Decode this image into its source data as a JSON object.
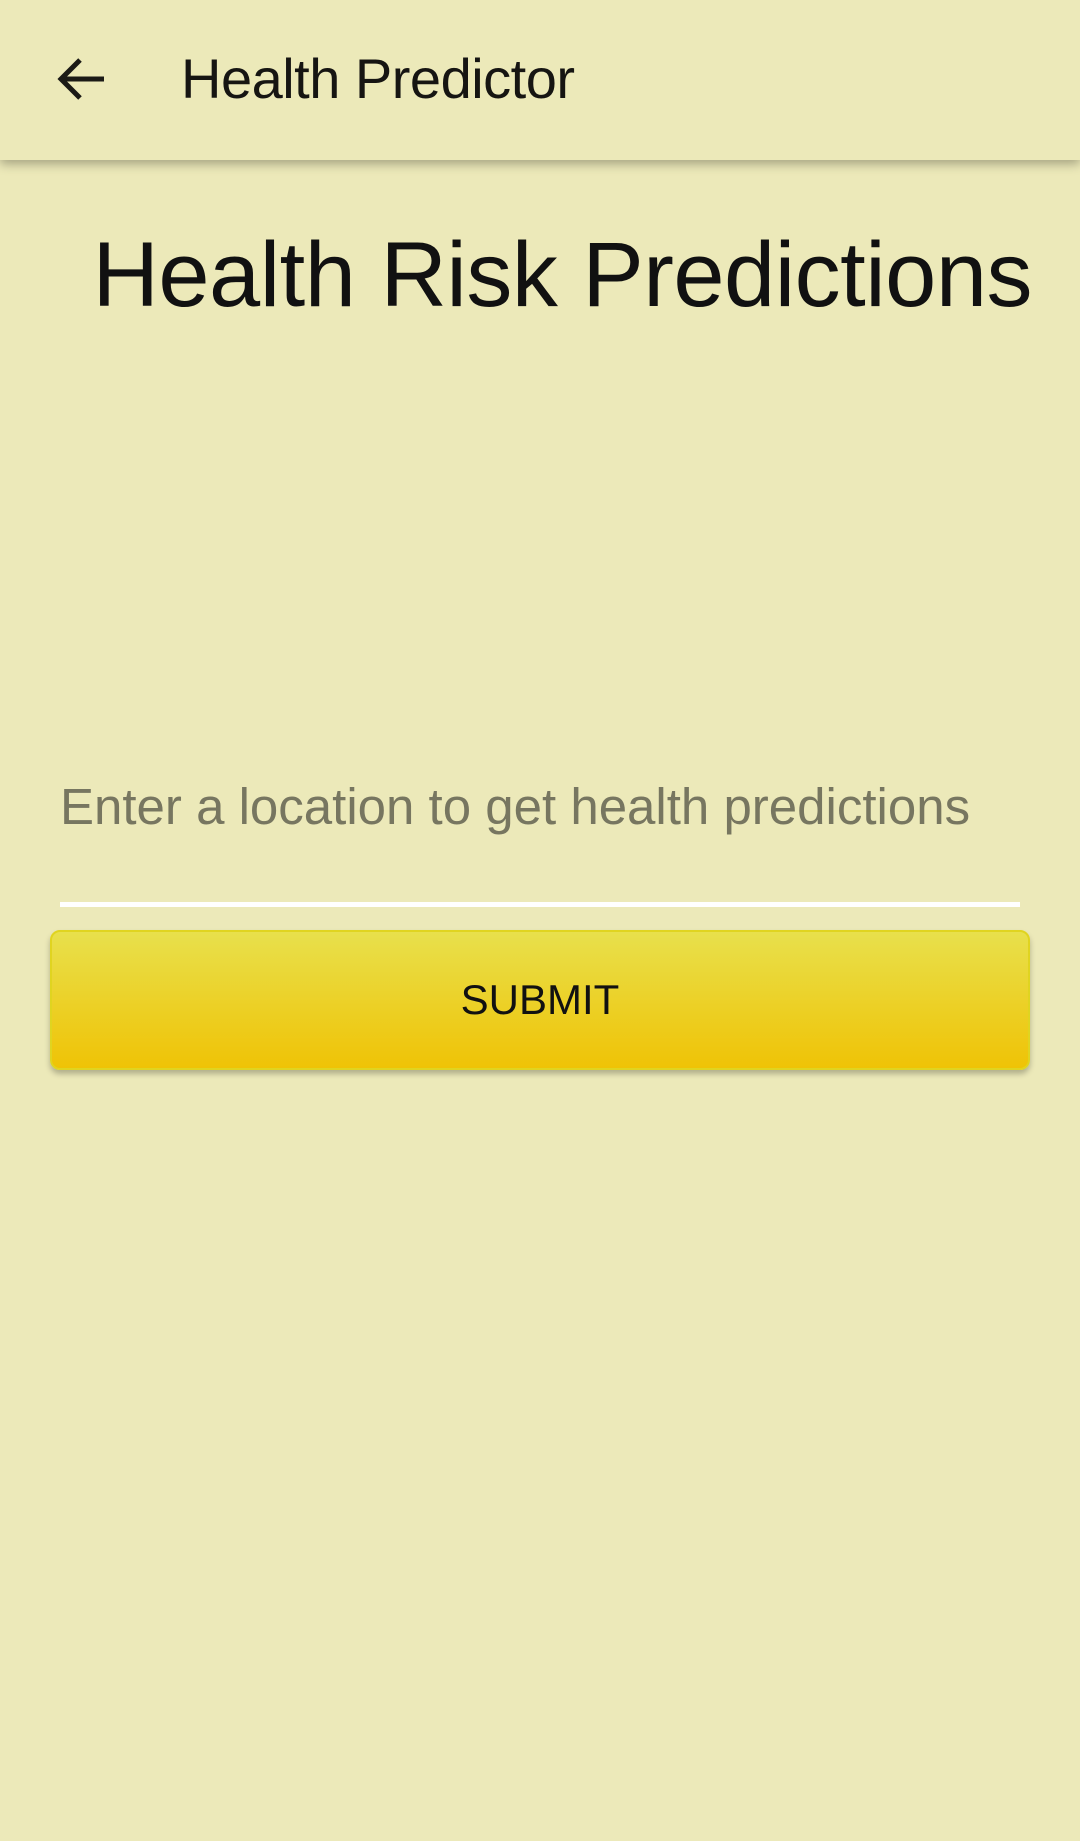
{
  "appbar": {
    "title": "Health Predictor",
    "back_icon": "arrow-left-icon"
  },
  "main": {
    "heading": "Health Risk Predictions",
    "location_input": {
      "placeholder": "Enter a location to get health predictions",
      "value": ""
    },
    "submit_label": "SUBMIT"
  },
  "colors": {
    "background": "#ece9b9",
    "button": "#ecd62a",
    "underline": "#ffffff"
  }
}
